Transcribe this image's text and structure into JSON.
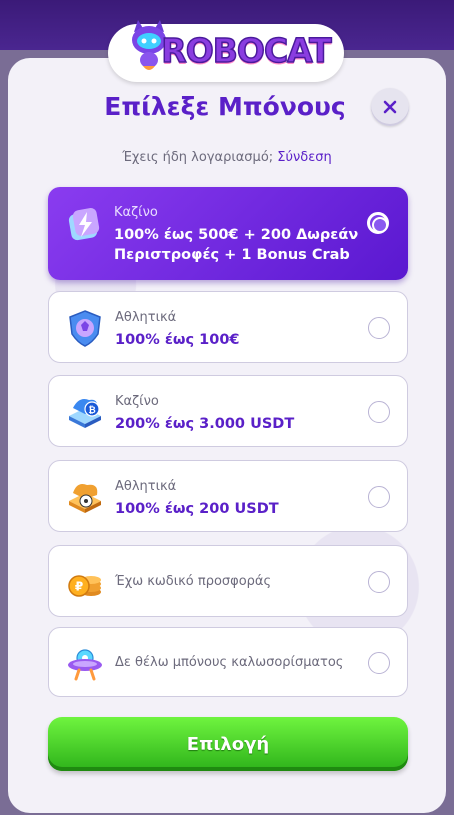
{
  "brand": {
    "logo_text": "ROBOCAT"
  },
  "modal": {
    "title": "Επίλεξε Μπόνους",
    "close_icon": "close-icon",
    "login_prompt": "Έχεις ήδη λογαριασμό;",
    "login_link": "Σύνδεση"
  },
  "options": [
    {
      "category": "Καζίνο",
      "description": "100% έως 500€ + 200 Δωρεάν Περιστροφές + 1 Bonus Crab",
      "icon": "casino-bolt-icon",
      "selected": true
    },
    {
      "category": "Αθλητικά",
      "description": "100% έως 100€",
      "icon": "sports-shield-icon",
      "selected": false
    },
    {
      "category": "Καζίνο",
      "description": "200% έως 3.000 USDT",
      "icon": "crypto-casino-icon",
      "selected": false
    },
    {
      "category": "Αθλητικά",
      "description": "100% έως 200 USDT",
      "icon": "crypto-sports-icon",
      "selected": false
    },
    {
      "label": "Έχω κωδικό προσφοράς",
      "icon": "coins-icon",
      "selected": false
    },
    {
      "label": "Δε θέλω μπόνους καλωσορίσματος",
      "icon": "ufo-icon",
      "selected": false
    }
  ],
  "submit_label": "Επιλογή",
  "colors": {
    "accent": "#5a20c8",
    "selected_gradient_start": "#8a3cf0",
    "selected_gradient_end": "#5a18d0",
    "submit_green": "#3cc624"
  }
}
